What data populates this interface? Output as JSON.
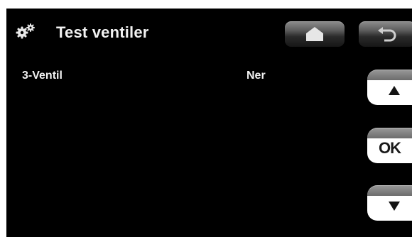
{
  "header": {
    "title": "Test ventiler",
    "icon": "gears-icon",
    "home_icon": "home-icon",
    "back_icon": "back-arrow-icon"
  },
  "rows": [
    {
      "label": "3-Ventil",
      "value": "Ner"
    }
  ],
  "side_buttons": {
    "up_icon": "arrow-up-icon",
    "ok_label": "OK",
    "down_icon": "arrow-down-icon"
  },
  "colors": {
    "background": "#000000",
    "text": "#f2f2f2",
    "button_face": "#ffffff",
    "button_top": "#8d8d8d"
  }
}
